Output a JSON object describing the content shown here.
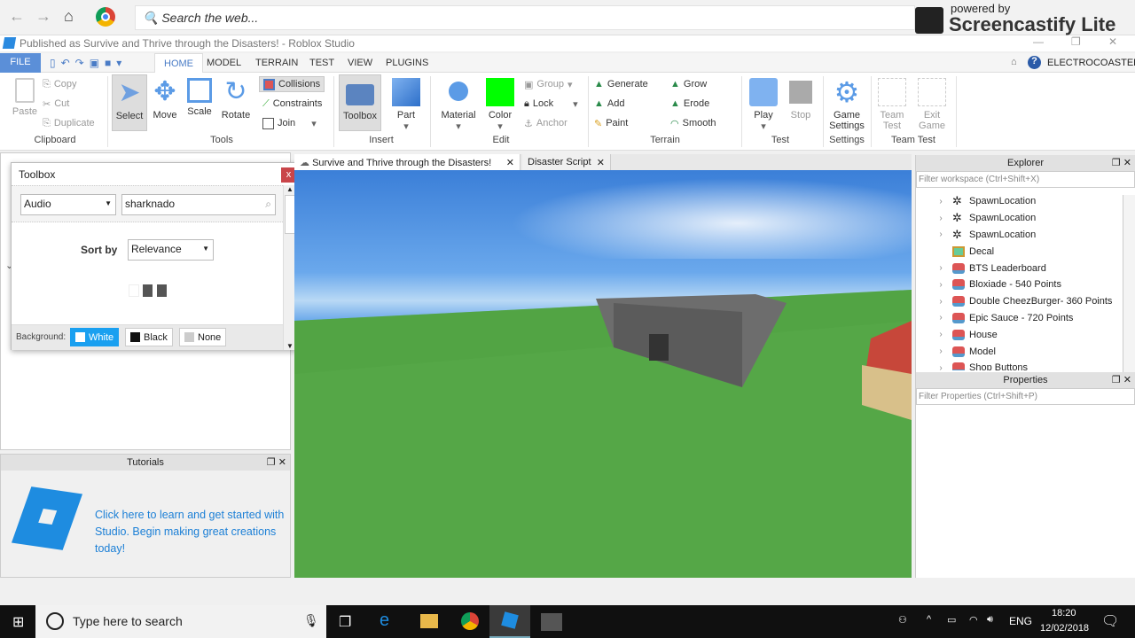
{
  "browser": {
    "search_placeholder": "Search the web...",
    "watermark_top": "powered by",
    "watermark_brand": "Screencastify Lite"
  },
  "window": {
    "title": "Published as Survive and Thrive through the Disasters! - Roblox Studio",
    "user": "ELECTROCOASTER"
  },
  "ribbon_tabs": [
    "FILE",
    "HOME",
    "MODEL",
    "TERRAIN",
    "TEST",
    "VIEW",
    "PLUGINS"
  ],
  "ribbon": {
    "clipboard": {
      "label": "Clipboard",
      "paste": "Paste",
      "copy": "Copy",
      "cut": "Cut",
      "duplicate": "Duplicate"
    },
    "tools": {
      "label": "Tools",
      "select": "Select",
      "move": "Move",
      "scale": "Scale",
      "rotate": "Rotate",
      "collisions": "Collisions",
      "constraints": "Constraints",
      "join": "Join"
    },
    "insert": {
      "label": "Insert",
      "toolbox": "Toolbox",
      "part": "Part"
    },
    "edit": {
      "label": "Edit",
      "material": "Material",
      "color": "Color",
      "group": "Group",
      "lock": "Lock",
      "anchor": "Anchor",
      "color_value": "#00ff00"
    },
    "terrain": {
      "label": "Terrain",
      "generate": "Generate",
      "add": "Add",
      "paint": "Paint",
      "grow": "Grow",
      "erode": "Erode",
      "smooth": "Smooth"
    },
    "test": {
      "label": "Test",
      "play": "Play",
      "stop": "Stop"
    },
    "settings": {
      "label": "Settings",
      "game_settings_1": "Game",
      "game_settings_2": "Settings"
    },
    "team_test": {
      "label": "Team Test",
      "team_1": "Team",
      "team_2": "Test",
      "exit_1": "Exit",
      "exit_2": "Game"
    }
  },
  "toolbox": {
    "title": "Toolbox",
    "close": "x",
    "category": "Audio",
    "search_value": "sharknado",
    "sort_label": "Sort by",
    "sort_value": "Relevance",
    "background_label": "Background:",
    "bg_options": [
      "White",
      "Black",
      "None"
    ],
    "bg_selected": "White"
  },
  "viewport_tabs": [
    "Survive and Thrive through the Disasters!",
    "Disaster Script"
  ],
  "explorer": {
    "title": "Explorer",
    "filter_placeholder": "Filter workspace (Ctrl+Shift+X)",
    "items": [
      {
        "label": "SpawnLocation",
        "icon": "spawn-icon",
        "expandable": true
      },
      {
        "label": "SpawnLocation",
        "icon": "spawn-icon",
        "expandable": true
      },
      {
        "label": "SpawnLocation",
        "icon": "spawn-icon",
        "expandable": true
      },
      {
        "label": "Decal",
        "icon": "decal-icon",
        "expandable": false
      },
      {
        "label": "BTS Leaderboard",
        "icon": "model-icon",
        "expandable": true
      },
      {
        "label": "Bloxiade - 540 Points",
        "icon": "model-icon",
        "expandable": true
      },
      {
        "label": "Double CheezBurger- 360 Points",
        "icon": "model-icon",
        "expandable": true
      },
      {
        "label": "Epic Sauce - 720 Points",
        "icon": "model-icon",
        "expandable": true
      },
      {
        "label": "House",
        "icon": "model-icon",
        "expandable": true
      },
      {
        "label": "Model",
        "icon": "model-icon",
        "expandable": true
      },
      {
        "label": "Shop Buttons",
        "icon": "model-icon",
        "expandable": true
      }
    ]
  },
  "properties": {
    "title": "Properties",
    "filter_placeholder": "Filter Properties (Ctrl+Shift+P)"
  },
  "tutorials": {
    "title": "Tutorials",
    "text": "Click here to learn and get started with Studio. Begin making great creations today!"
  },
  "taskbar": {
    "search_placeholder": "Type here to search",
    "lang": "ENG",
    "time": "18:20",
    "date": "12/02/2018"
  }
}
